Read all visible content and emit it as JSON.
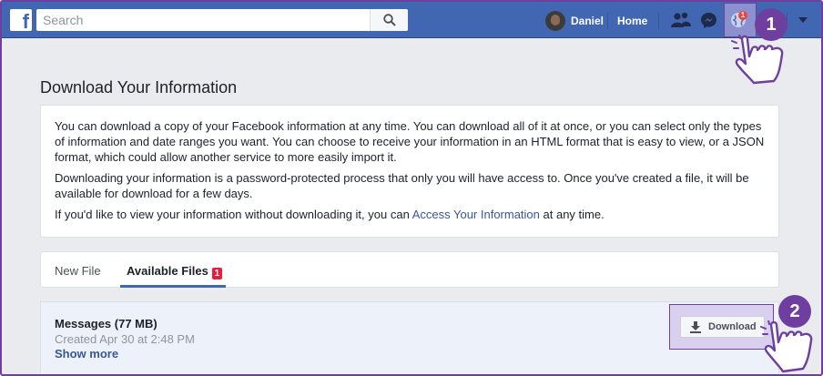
{
  "header": {
    "logo_letter": "f",
    "search_placeholder": "Search",
    "profile_name": "Daniel",
    "home_label": "Home",
    "notification_count": "1"
  },
  "annotations": {
    "step1": "1",
    "step2": "2",
    "highlight_color": "#6f3fa0"
  },
  "page": {
    "title": "Download Your Information",
    "intro_paragraph": "You can download a copy of your Facebook information at any time. You can download all of it at once, or you can select only the types of information and date ranges you want. You can choose to receive your information in an HTML format that is easy to view, or a JSON format, which could allow another service to more easily import it.",
    "password_paragraph": "Downloading your information is a password-protected process that only you will have access to. Once you've created a file, it will be available for download for a few days.",
    "view_prefix": "If you'd like to view your information without downloading it, you can ",
    "view_link": "Access Your Information",
    "view_suffix": " at any time."
  },
  "tabs": {
    "new_file": "New File",
    "available_files": "Available Files",
    "available_badge": "1"
  },
  "file": {
    "name": "Messages (77 MB)",
    "created": "Created Apr 30 at 2:48 PM",
    "show_more": "Show more",
    "download_label": "Download"
  },
  "colors": {
    "topbar": "#4267b2",
    "accent": "#6f3fa0",
    "badge": "#fa3e3e"
  }
}
